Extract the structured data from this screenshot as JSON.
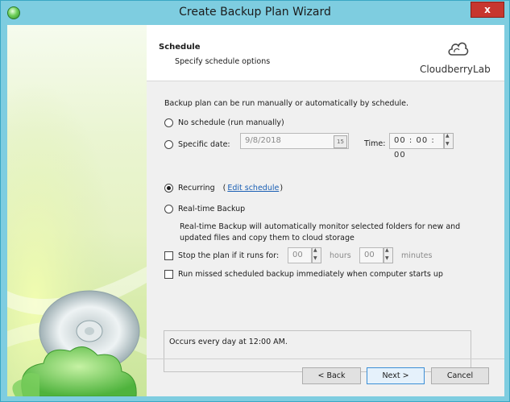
{
  "window": {
    "title": "Create Backup Plan Wizard",
    "close_glyph": "x"
  },
  "header": {
    "title": "Schedule",
    "subtitle": "Specify schedule options",
    "logo_text": "CloudberryLab"
  },
  "intro": "Backup plan can be run manually or automatically by schedule.",
  "options": {
    "no_schedule": {
      "label": "No schedule (run manually)",
      "checked": false
    },
    "specific_date": {
      "label": "Specific date:",
      "checked": false,
      "date_value": "9/8/2018",
      "calendar_glyph": "15",
      "time_label": "Time:",
      "time_value": "00 : 00 : 00"
    },
    "recurring": {
      "label": "Recurring",
      "checked": true,
      "open_paren": "(",
      "link": "Edit schedule",
      "close_paren": ")"
    },
    "realtime": {
      "label": "Real-time Backup",
      "checked": false,
      "description_line1": "Real-time Backup will automatically monitor selected folders for new and",
      "description_line2": "updated files and copy them to cloud storage"
    }
  },
  "stop_plan": {
    "label": "Stop the plan if it runs for:",
    "checked": false,
    "hours_value": "00",
    "hours_label": "hours",
    "minutes_value": "00",
    "minutes_label": "minutes"
  },
  "run_missed": {
    "label": "Run missed scheduled backup immediately when computer starts up",
    "checked": false
  },
  "summary": "Occurs every day at 12:00 AM.",
  "buttons": {
    "back": "< Back",
    "next": "Next >",
    "cancel": "Cancel"
  },
  "colors": {
    "titlebar": "#7ecde0",
    "close": "#c7372f",
    "link": "#1a5fb4",
    "primary_border": "#3c8fd6"
  }
}
